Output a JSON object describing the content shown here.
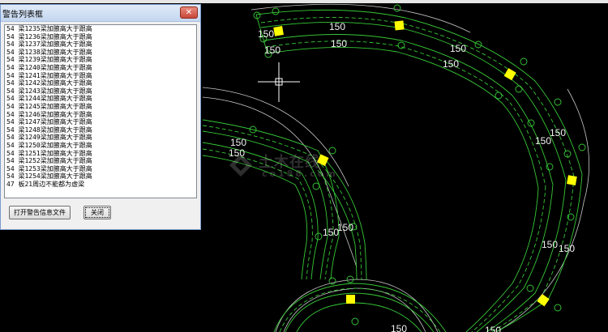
{
  "dialog": {
    "title": "警告列表框",
    "close_glyph": "✕",
    "rows": [
      "54 梁1235梁加腋高大于跟高",
      "54 梁1236梁加腋高大于跟高",
      "54 梁1237梁加腋高大于跟高",
      "54 梁1238梁加腋高大于跟高",
      "54 梁1239梁加腋高大于跟高",
      "54 梁1240梁加腋高大于跟高",
      "54 梁1241梁加腋高大于跟高",
      "54 梁1242梁加腋高大于跟高",
      "54 梁1243梁加腋高大于跟高",
      "54 梁1244梁加腋高大于跟高",
      "54 梁1245梁加腋高大于跟高",
      "54 梁1246梁加腋高大于跟高",
      "54 梁1247梁加腋高大于跟高",
      "54 梁1248梁加腋高大于跟高",
      "54 梁1249梁加腋高大于跟高",
      "54 梁1250梁加腋高大于跟高",
      "54 梁1251梁加腋高大于跟高",
      "54 梁1252梁加腋高大于跟高",
      "54 梁1253梁加腋高大于跟高",
      "54 梁1254梁加腋高大于跟高",
      "47 板21周边不能都为虚梁"
    ],
    "buttons": {
      "open_file": "打开警告信息文件",
      "close": "关闭"
    }
  },
  "drawing": {
    "dimension_labels": [
      "150",
      "150",
      "150",
      "150",
      "150",
      "150",
      "150",
      "150",
      "150",
      "150",
      "150",
      "150",
      "150",
      "150",
      "150",
      "150"
    ],
    "watermark": {
      "text": "土木在线",
      "sub": "co188.com"
    }
  },
  "colors": {
    "background": "#000000",
    "beam_lines": "#37c837",
    "column": "#ffff00",
    "arcs": "#c8c8c8",
    "crosshair": "#ffffff"
  }
}
